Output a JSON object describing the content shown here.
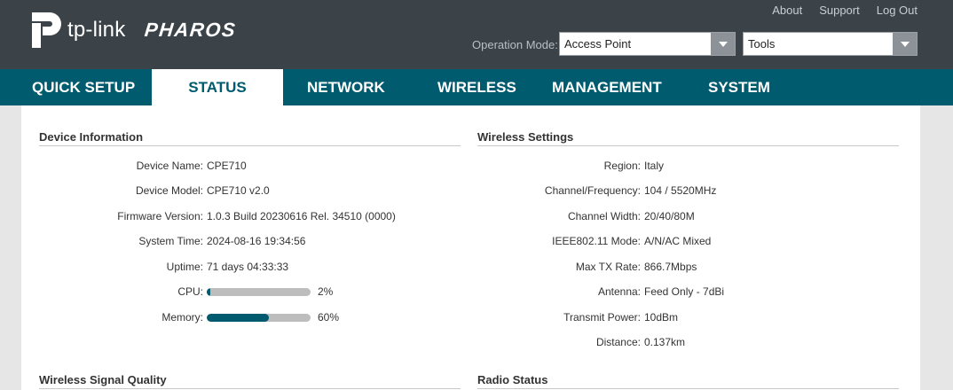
{
  "header": {
    "brand": "tp-link",
    "product": "PHAROS",
    "links": [
      "About",
      "Support",
      "Log Out"
    ],
    "op_mode_label": "Operation Mode:",
    "op_mode_value": "Access Point",
    "tools_value": "Tools"
  },
  "nav": {
    "items": [
      "QUICK SETUP",
      "STATUS",
      "NETWORK",
      "WIRELESS",
      "MANAGEMENT",
      "SYSTEM"
    ],
    "active": "STATUS"
  },
  "device_info": {
    "title": "Device Information",
    "rows": [
      {
        "label": "Device Name:",
        "value": "CPE710"
      },
      {
        "label": "Device Model:",
        "value": "CPE710 v2.0"
      },
      {
        "label": "Firmware Version:",
        "value": "1.0.3 Build 20230616 Rel. 34510 (0000)"
      },
      {
        "label": "System Time:",
        "value": "2024-08-16 19:34:56"
      },
      {
        "label": "Uptime:",
        "value": "71 days 04:33:33"
      }
    ],
    "cpu": {
      "label": "CPU:",
      "percent": 2,
      "text": "2%"
    },
    "memory": {
      "label": "Memory:",
      "percent": 60,
      "text": "60%"
    }
  },
  "wireless_settings": {
    "title": "Wireless Settings",
    "rows": [
      {
        "label": "Region:",
        "value": "Italy"
      },
      {
        "label": "Channel/Frequency:",
        "value": "104 / 5520MHz"
      },
      {
        "label": "Channel Width:",
        "value": "20/40/80M"
      },
      {
        "label": "IEEE802.11 Mode:",
        "value": "A/N/AC Mixed"
      },
      {
        "label": "Max TX Rate:",
        "value": "866.7Mbps"
      },
      {
        "label": "Antenna:",
        "value": "Feed Only - 7dBi"
      },
      {
        "label": "Transmit Power:",
        "value": "10dBm"
      },
      {
        "label": "Distance:",
        "value": "0.137km"
      }
    ]
  },
  "signal_quality": {
    "title": "Wireless Signal Quality"
  },
  "radio_status": {
    "title": "Radio Status"
  },
  "colors": {
    "header": "#3b4349",
    "nav": "#005b6e",
    "bar_fill": "#005b6e",
    "bar_track": "#bdbdbd"
  }
}
